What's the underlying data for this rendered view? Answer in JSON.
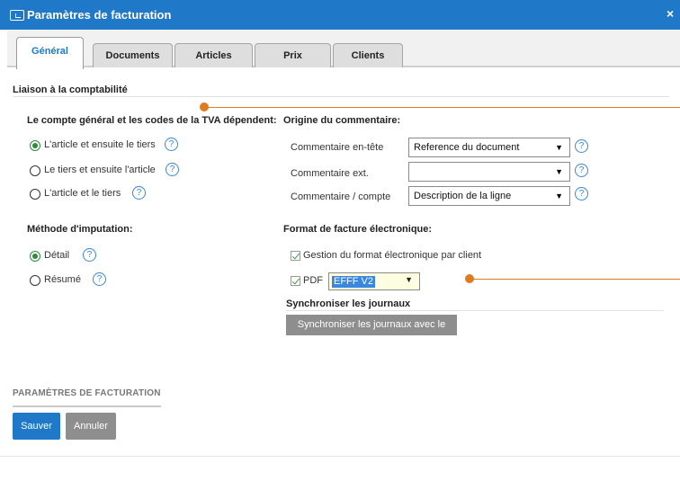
{
  "window": {
    "title": "Paramètres de facturation",
    "close_glyph": "×"
  },
  "tabs": [
    {
      "label": "Général",
      "active": true
    },
    {
      "label": "Documents",
      "active": false
    },
    {
      "label": "Articles",
      "active": false
    },
    {
      "label": "Prix",
      "active": false
    },
    {
      "label": "Clients",
      "active": false
    }
  ],
  "liaison": {
    "title": "Liaison à la comptabilité"
  },
  "compte_general": {
    "title": "Le compte général et les codes de la TVA dépendent:",
    "options": [
      {
        "label": "L'article et ensuite le tiers",
        "checked": true
      },
      {
        "label": "Le tiers et ensuite l'article",
        "checked": false
      },
      {
        "label": "L'article et le tiers",
        "checked": false
      }
    ]
  },
  "imputation": {
    "title": "Méthode d'imputation:",
    "options": [
      {
        "label": "Détail",
        "checked": true
      },
      {
        "label": "Résumé",
        "checked": false
      }
    ]
  },
  "origine": {
    "title": "Origine du commentaire:",
    "rows": [
      {
        "label": "Commentaire en-tête",
        "value": "Reference du document"
      },
      {
        "label": "Commentaire ext.",
        "value": ""
      },
      {
        "label": "Commentaire / compte",
        "value": "Description de la ligne"
      }
    ]
  },
  "format": {
    "title": "Format de facture électronique:",
    "gestion_label": "Gestion du format électronique par client",
    "gestion_checked": true,
    "pdf_label": "PDF",
    "pdf_checked": true,
    "pdf_value": "EFFF V2"
  },
  "synchro": {
    "title": "Synchroniser les journaux",
    "button_label": "Synchroniser les journaux avec le DEP"
  },
  "footer": {
    "title": "PARAMÈTRES DE FACTURATION",
    "save_label": "Sauver",
    "cancel_label": "Annuler"
  },
  "help_glyph": "?",
  "dropdown_glyph": "▼",
  "colors": {
    "accent": "#1f78c8",
    "annotation": "#e07a1f",
    "radio_checked": "#2e8b3c",
    "button_gray": "#8e8e8e"
  },
  "icons": [
    "window-icon",
    "close-icon",
    "help-icon",
    "chevron-down-icon",
    "checkbox-check-icon"
  ]
}
